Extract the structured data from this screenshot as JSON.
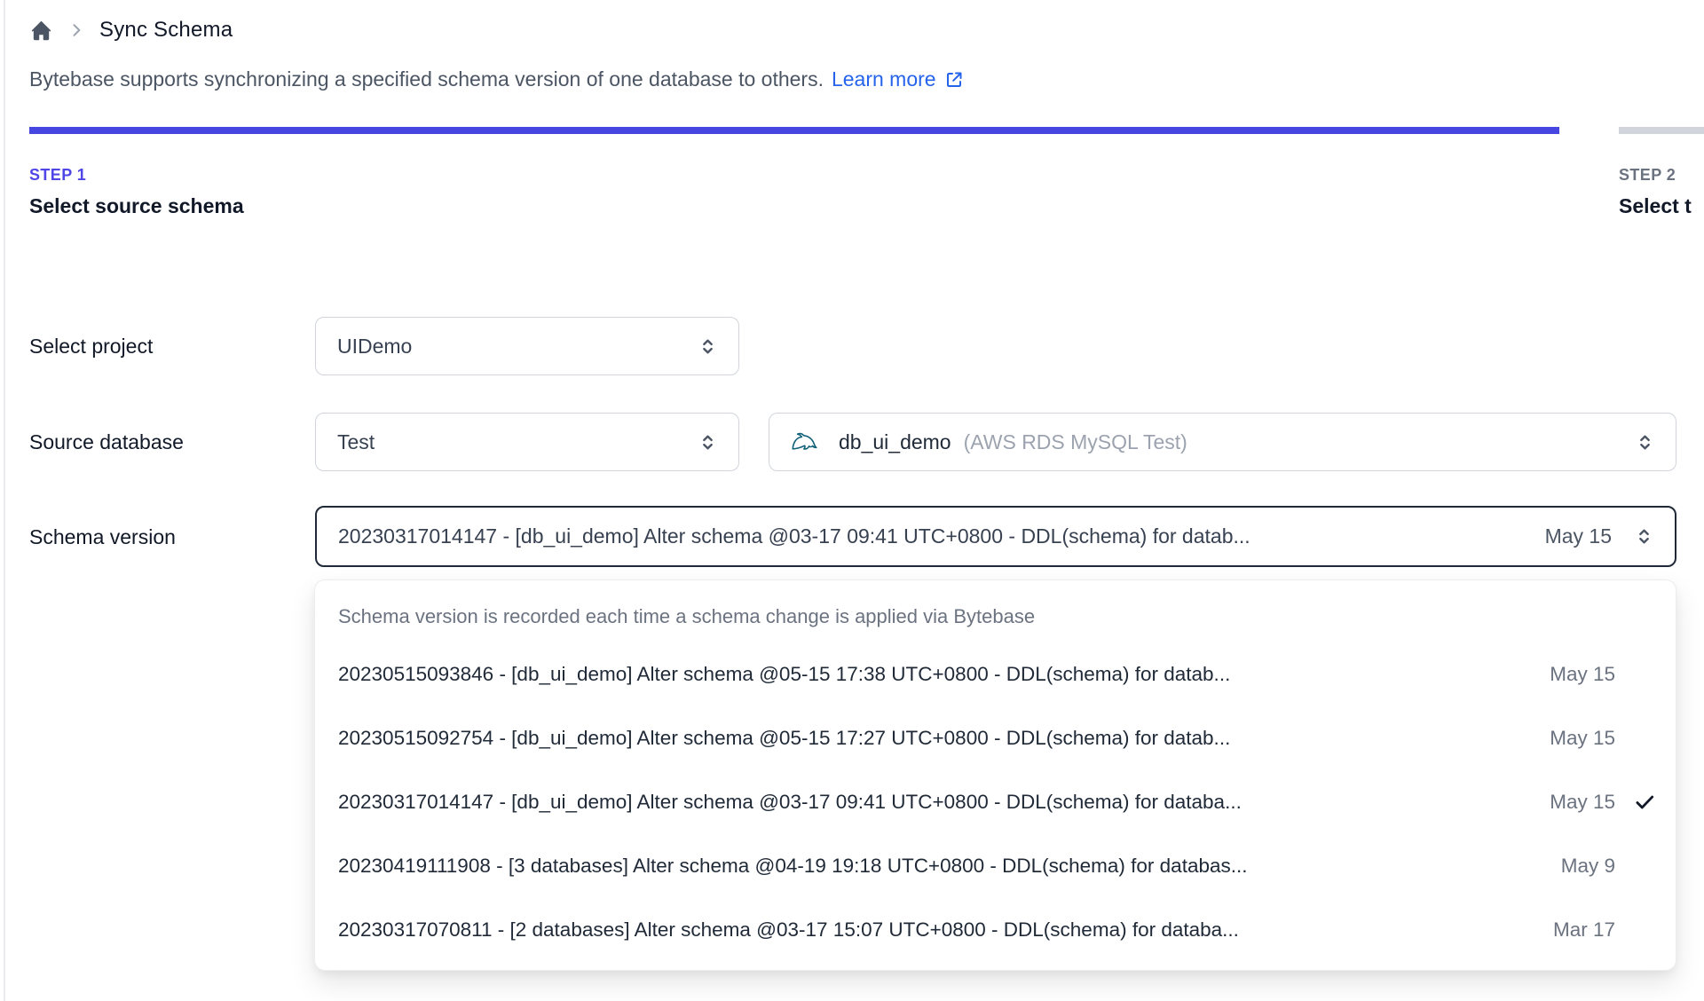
{
  "breadcrumb": {
    "title": "Sync Schema"
  },
  "description": {
    "text": "Bytebase supports synchronizing a specified schema version of one database to others.",
    "link_label": "Learn more"
  },
  "steps": [
    {
      "id": "STEP 1",
      "label": "Select source schema",
      "active": true
    },
    {
      "id": "STEP 2",
      "label": "Select t",
      "active": false
    }
  ],
  "form": {
    "project": {
      "label": "Select project",
      "value": "UIDemo"
    },
    "source_database": {
      "label": "Source database",
      "env_value": "Test",
      "db_value": "db_ui_demo",
      "db_detail": "(AWS RDS MySQL Test)",
      "db_engine_icon": "mysql-icon"
    },
    "schema_version": {
      "label": "Schema version",
      "value": "20230317014147 - [db_ui_demo] Alter schema @03-17 09:41 UTC+0800 - DDL(schema) for datab...",
      "value_date": "May 15"
    }
  },
  "dropdown": {
    "hint": "Schema version is recorded each time a schema change is applied via Bytebase",
    "options": [
      {
        "text": "20230515093846 - [db_ui_demo] Alter schema @05-15 17:38 UTC+0800 - DDL(schema) for datab...",
        "date": "May 15",
        "selected": false
      },
      {
        "text": "20230515092754 - [db_ui_demo] Alter schema @05-15 17:27 UTC+0800 - DDL(schema) for datab...",
        "date": "May 15",
        "selected": false
      },
      {
        "text": "20230317014147 - [db_ui_demo] Alter schema @03-17 09:41 UTC+0800 - DDL(schema) for databa...",
        "date": "May 15",
        "selected": true
      },
      {
        "text": "20230419111908 - [3 databases] Alter schema @04-19 19:18 UTC+0800 - DDL(schema) for databas...",
        "date": "May 9",
        "selected": false
      },
      {
        "text": "20230317070811 - [2 databases] Alter schema @03-17 15:07 UTC+0800 - DDL(schema) for databa...",
        "date": "Mar 17",
        "selected": false
      }
    ]
  },
  "colors": {
    "accent_indigo": "#4f46e5",
    "progress_active": "#4547e0",
    "progress_inactive": "#d1d5db",
    "link_blue": "#2563eb",
    "focus_border": "#1f2937",
    "mysql_teal": "#0d5e77"
  }
}
